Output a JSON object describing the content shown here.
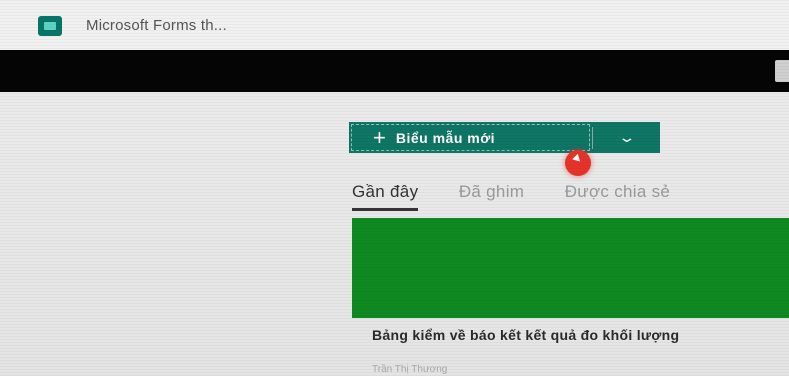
{
  "window": {
    "title": "Microsoft Forms th...",
    "app_icon": "forms-icon"
  },
  "toolbar": {
    "new_form_label": "Biểu mẫu mới",
    "new_form_icon": "plus-icon",
    "dropdown_icon": "chevron-down-icon"
  },
  "tabs": [
    {
      "label": "Gần đây",
      "active": true
    },
    {
      "label": "Đã ghim",
      "active": false
    },
    {
      "label": "Được chia sẻ",
      "active": false
    }
  ],
  "forms": [
    {
      "title": "Bảng kiểm về báo kết kết quả đo khối lượng",
      "owner": "Trần Thị Thương",
      "thumbnail_color": "#0f8a21"
    }
  ],
  "colors": {
    "accent": "#0f7564",
    "thumbnail": "#0f8a21",
    "cursor_highlight": "#e5332a"
  }
}
